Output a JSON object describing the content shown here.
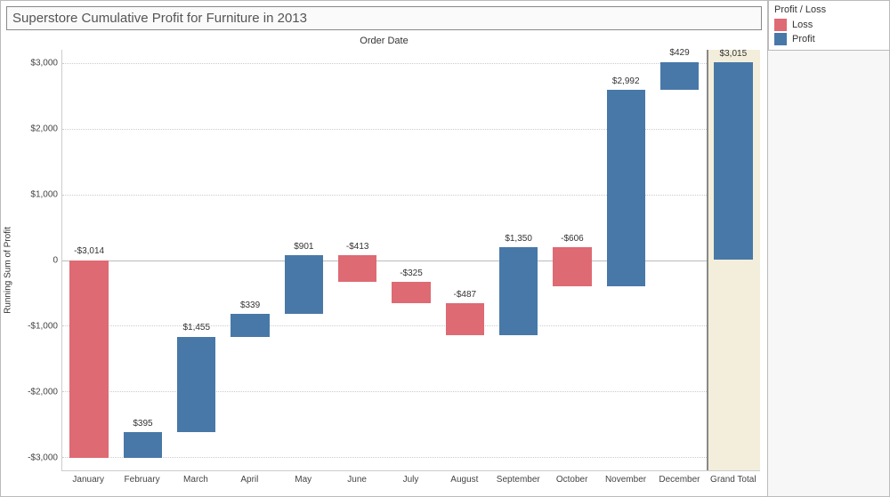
{
  "title": "Superstore Cumulative Profit for Furniture in 2013",
  "axis_title_top": "Order Date",
  "y_axis_title": "Running Sum of Profit",
  "legend": {
    "title": "Profit / Loss",
    "items": [
      "Loss",
      "Profit"
    ]
  },
  "y_ticks": [
    "$3,000",
    "$2,000",
    "$1,000",
    "0",
    "-$1,000",
    "-$2,000",
    "-$3,000"
  ],
  "categories": [
    "January",
    "February",
    "March",
    "April",
    "May",
    "June",
    "July",
    "August",
    "September",
    "October",
    "November",
    "December",
    "Grand Total"
  ],
  "bar_labels": [
    "-$3,014",
    "$395",
    "$1,455",
    "$339",
    "$901",
    "-$413",
    "-$325",
    "-$487",
    "$1,350",
    "-$606",
    "$2,992",
    "$429",
    "$3,015"
  ],
  "chart_data": {
    "type": "bar",
    "subtype": "waterfall",
    "title": "Superstore Cumulative Profit for Furniture in 2013",
    "xlabel": "Order Date",
    "ylabel": "Running Sum of Profit",
    "ylim": [
      -3200,
      3200
    ],
    "categories": [
      "January",
      "February",
      "March",
      "April",
      "May",
      "June",
      "July",
      "August",
      "September",
      "October",
      "November",
      "December",
      "Grand Total"
    ],
    "series": [
      {
        "name": "January",
        "type": "Loss",
        "value": -3014,
        "start": 0,
        "end": -3014
      },
      {
        "name": "February",
        "type": "Profit",
        "value": 395,
        "start": -3014,
        "end": -2619
      },
      {
        "name": "March",
        "type": "Profit",
        "value": 1455,
        "start": -2619,
        "end": -1164
      },
      {
        "name": "April",
        "type": "Profit",
        "value": 339,
        "start": -1164,
        "end": -825
      },
      {
        "name": "May",
        "type": "Profit",
        "value": 901,
        "start": -825,
        "end": 76
      },
      {
        "name": "June",
        "type": "Loss",
        "value": -413,
        "start": 76,
        "end": -337
      },
      {
        "name": "July",
        "type": "Loss",
        "value": -325,
        "start": -337,
        "end": -662
      },
      {
        "name": "August",
        "type": "Loss",
        "value": -487,
        "start": -662,
        "end": -1149
      },
      {
        "name": "September",
        "type": "Profit",
        "value": 1350,
        "start": -1149,
        "end": 201
      },
      {
        "name": "October",
        "type": "Loss",
        "value": -606,
        "start": 201,
        "end": -405
      },
      {
        "name": "November",
        "type": "Profit",
        "value": 2992,
        "start": -405,
        "end": 2587
      },
      {
        "name": "December",
        "type": "Profit",
        "value": 429,
        "start": 2587,
        "end": 3016
      },
      {
        "name": "Grand Total",
        "type": "Total",
        "value": 3015,
        "start": 0,
        "end": 3015
      }
    ],
    "legend": {
      "Loss": "#de6a73",
      "Profit": "#4878a8"
    }
  }
}
